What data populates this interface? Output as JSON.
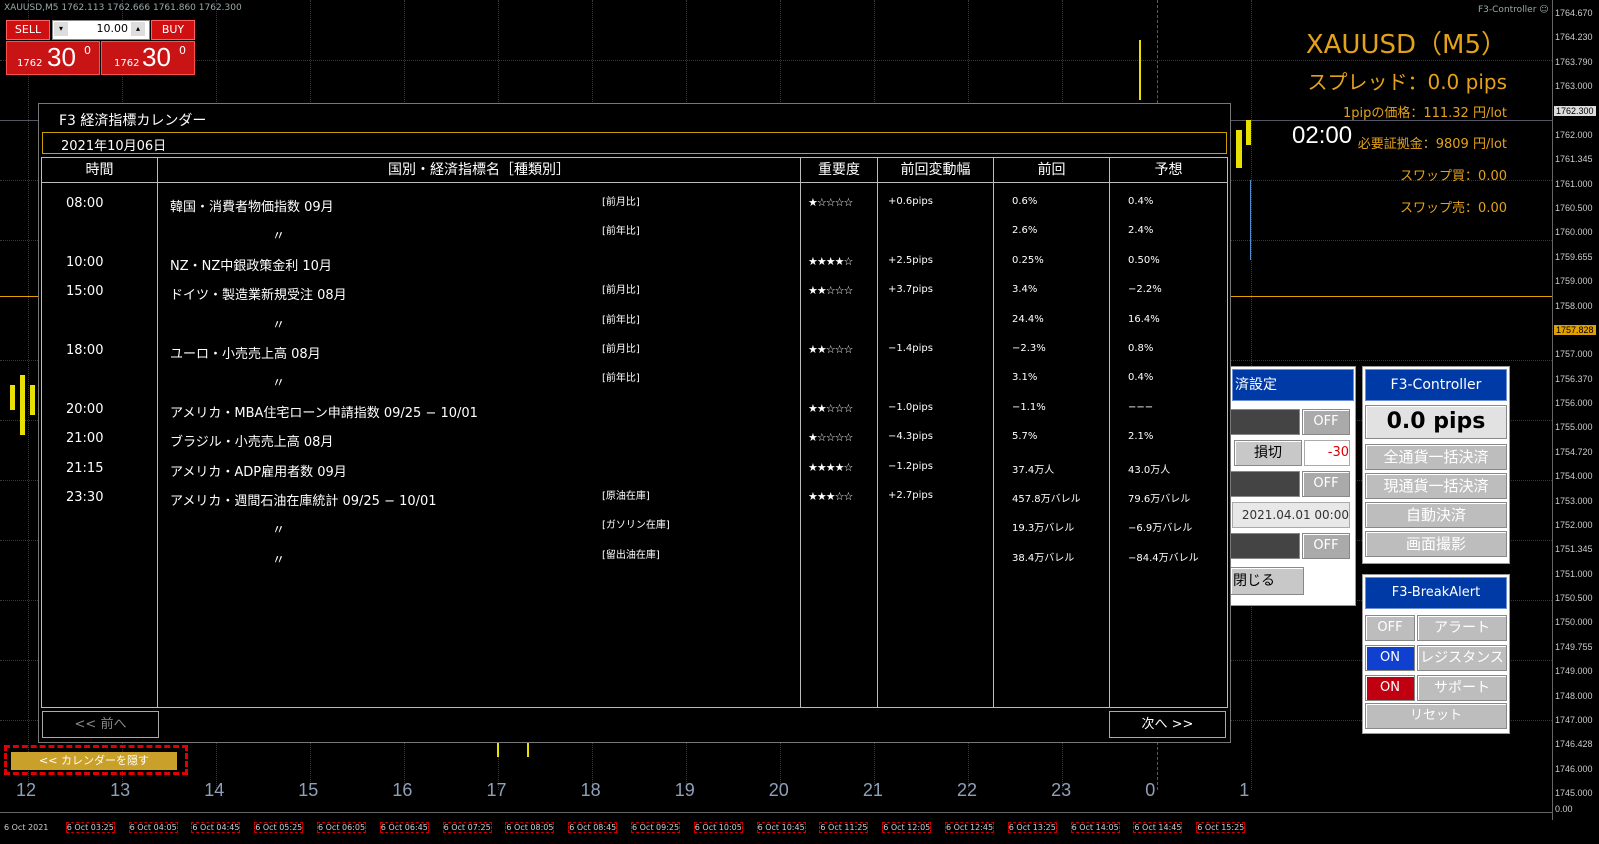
{
  "chart": {
    "info": "XAUUSD,M5  1762.113 1762.666 1761.860 1762.300",
    "controller_title": "F3-Controller ☺",
    "price_ticks": [
      "1764.670",
      "1764.230",
      "1763.790",
      "1763.000",
      "1762.300",
      "1762.000",
      "1761.345",
      "1761.000",
      "1760.500",
      "1760.000",
      "1759.655",
      "1759.000",
      "1758.000",
      "1757.828",
      "1757.000",
      "1756.370",
      "1756.000",
      "1755.000",
      "1754.720",
      "1754.000",
      "1753.000",
      "1752.000",
      "1751.345",
      "1751.000",
      "1750.500",
      "1750.000",
      "1749.755",
      "1749.000",
      "1748.000",
      "1747.000",
      "1746.428",
      "1746.000",
      "1745.000",
      "0.00"
    ],
    "hour_labels": [
      "12",
      "13",
      "14",
      "15",
      "16",
      "17",
      "18",
      "19",
      "20",
      "21",
      "22",
      "23",
      "0",
      "1"
    ],
    "time_labels": [
      "6 Oct 2021",
      "6 Oct 03:25",
      "6 Oct 04:05",
      "6 Oct 04:45",
      "6 Oct 05:25",
      "6 Oct 06:05",
      "6 Oct 06:45",
      "6 Oct 07:25",
      "6 Oct 08:05",
      "6 Oct 08:45",
      "6 Oct 09:25",
      "6 Oct 10:05",
      "6 Oct 10:45",
      "6 Oct 11:25",
      "6 Oct 12:05",
      "6 Oct 12:45",
      "6 Oct 13:25",
      "6 Oct 14:05",
      "6 Oct 14:45",
      "6 Oct 15:25"
    ],
    "countdown": "02:00"
  },
  "trade": {
    "sell_label": "SELL",
    "buy_label": "BUY",
    "lots": "10.00",
    "sell_prefix": "1762",
    "sell_big": "30",
    "sell_sup": "0",
    "buy_prefix": "1762",
    "buy_big": "30",
    "buy_sup": "0"
  },
  "symbol": {
    "name": "XAUUSD（M5）",
    "spread": "スプレッド：0.0  pips",
    "pip_value": "1pipの価格：111.32  円/lot",
    "margin": "必要証拠金：9809  円/lot",
    "swap_buy": "スワップ買：0.00",
    "swap_sell": "スワップ売：0.00"
  },
  "calendar": {
    "title": "F3 経済指標カレンダー",
    "date": "2021年10月06日",
    "headers": [
      "時間",
      "国別・経済指標名［種類別］",
      "重要度",
      "前回変動幅",
      "前回",
      "予想"
    ],
    "rows": [
      {
        "time": "08:00",
        "name": "韓国・消費者物価指数 09月",
        "type": "[前月比]",
        "stars": "★☆☆☆☆",
        "change": "+0.6pips",
        "prev": "0.6%",
        "fore": "0.4%"
      },
      {
        "time": "",
        "name": "〃",
        "type": "[前年比]",
        "stars": "",
        "change": "",
        "prev": "2.6%",
        "fore": "2.4%"
      },
      {
        "time": "10:00",
        "name": "NZ・NZ中銀政策金利 10月",
        "type": "",
        "stars": "★★★★☆",
        "change": "+2.5pips",
        "prev": "0.25%",
        "fore": "0.50%"
      },
      {
        "time": "15:00",
        "name": "ドイツ・製造業新規受注 08月",
        "type": "[前月比]",
        "stars": "★★☆☆☆",
        "change": "+3.7pips",
        "prev": "3.4%",
        "fore": "−2.2%"
      },
      {
        "time": "",
        "name": "〃",
        "type": "[前年比]",
        "stars": "",
        "change": "",
        "prev": "24.4%",
        "fore": "16.4%"
      },
      {
        "time": "18:00",
        "name": "ユーロ・小売売上高 08月",
        "type": "[前月比]",
        "stars": "★★☆☆☆",
        "change": "−1.4pips",
        "prev": "−2.3%",
        "fore": "0.8%"
      },
      {
        "time": "",
        "name": "〃",
        "type": "[前年比]",
        "stars": "",
        "change": "",
        "prev": "3.1%",
        "fore": "0.4%"
      },
      {
        "time": "20:00",
        "name": "アメリカ・MBA住宅ローン申請指数 09/25 − 10/01",
        "type": "",
        "stars": "★★☆☆☆",
        "change": "−1.0pips",
        "prev": "−1.1%",
        "fore": "−−−"
      },
      {
        "time": "21:00",
        "name": "ブラジル・小売売上高 08月",
        "type": "",
        "stars": "★☆☆☆☆",
        "change": "−4.3pips",
        "prev": "5.7%",
        "fore": "2.1%"
      },
      {
        "time": "21:15",
        "name": "アメリカ・ADP雇用者数 09月",
        "type": "",
        "stars": "★★★★☆",
        "change": "−1.2pips",
        "prev": "37.4万人",
        "fore": "43.0万人"
      },
      {
        "time": "23:30",
        "name": "アメリカ・週間石油在庫統計 09/25 − 10/01",
        "type": "[原油在庫]",
        "stars": "★★★☆☆",
        "change": "+2.7pips",
        "prev": "457.8万バレル",
        "fore": "79.6万バレル"
      },
      {
        "time": "",
        "name": "〃",
        "type": "[ガソリン在庫]",
        "stars": "",
        "change": "",
        "prev": "19.3万バレル",
        "fore": "−6.9万バレル"
      },
      {
        "time": "",
        "name": "〃",
        "type": "[留出油在庫]",
        "stars": "",
        "change": "",
        "prev": "38.4万バレル",
        "fore": "−84.4万バレル"
      }
    ],
    "prev_btn": "<< 前へ",
    "next_btn": "次へ >>",
    "hide_btn": "<< カレンダーを隠す"
  },
  "settle": {
    "header": "済設定",
    "off1": "OFF",
    "sl_label": "損切",
    "sl_value": "-30",
    "off2": "OFF",
    "date_value": "2021.04.01 00:00",
    "off3": "OFF",
    "close": "閉じる"
  },
  "controller": {
    "header": "F3-Controller",
    "pips": "0.0 pips",
    "btn1": "全通貨一括決済",
    "btn2": "現通貨一括決済",
    "btn3": "自動決済",
    "btn4": "画面撮影"
  },
  "breakalert": {
    "header": "F3-BreakAlert",
    "r1_state": "OFF",
    "r1_label": "アラート",
    "r2_state": "ON",
    "r2_label": "レジスタンス",
    "r3_state": "ON",
    "r3_label": "サポート",
    "reset": "リセット"
  },
  "colors": {
    "accent_gold": "#e3a21a",
    "header_blue": "#003aa6",
    "sell_red": "#d01010"
  }
}
